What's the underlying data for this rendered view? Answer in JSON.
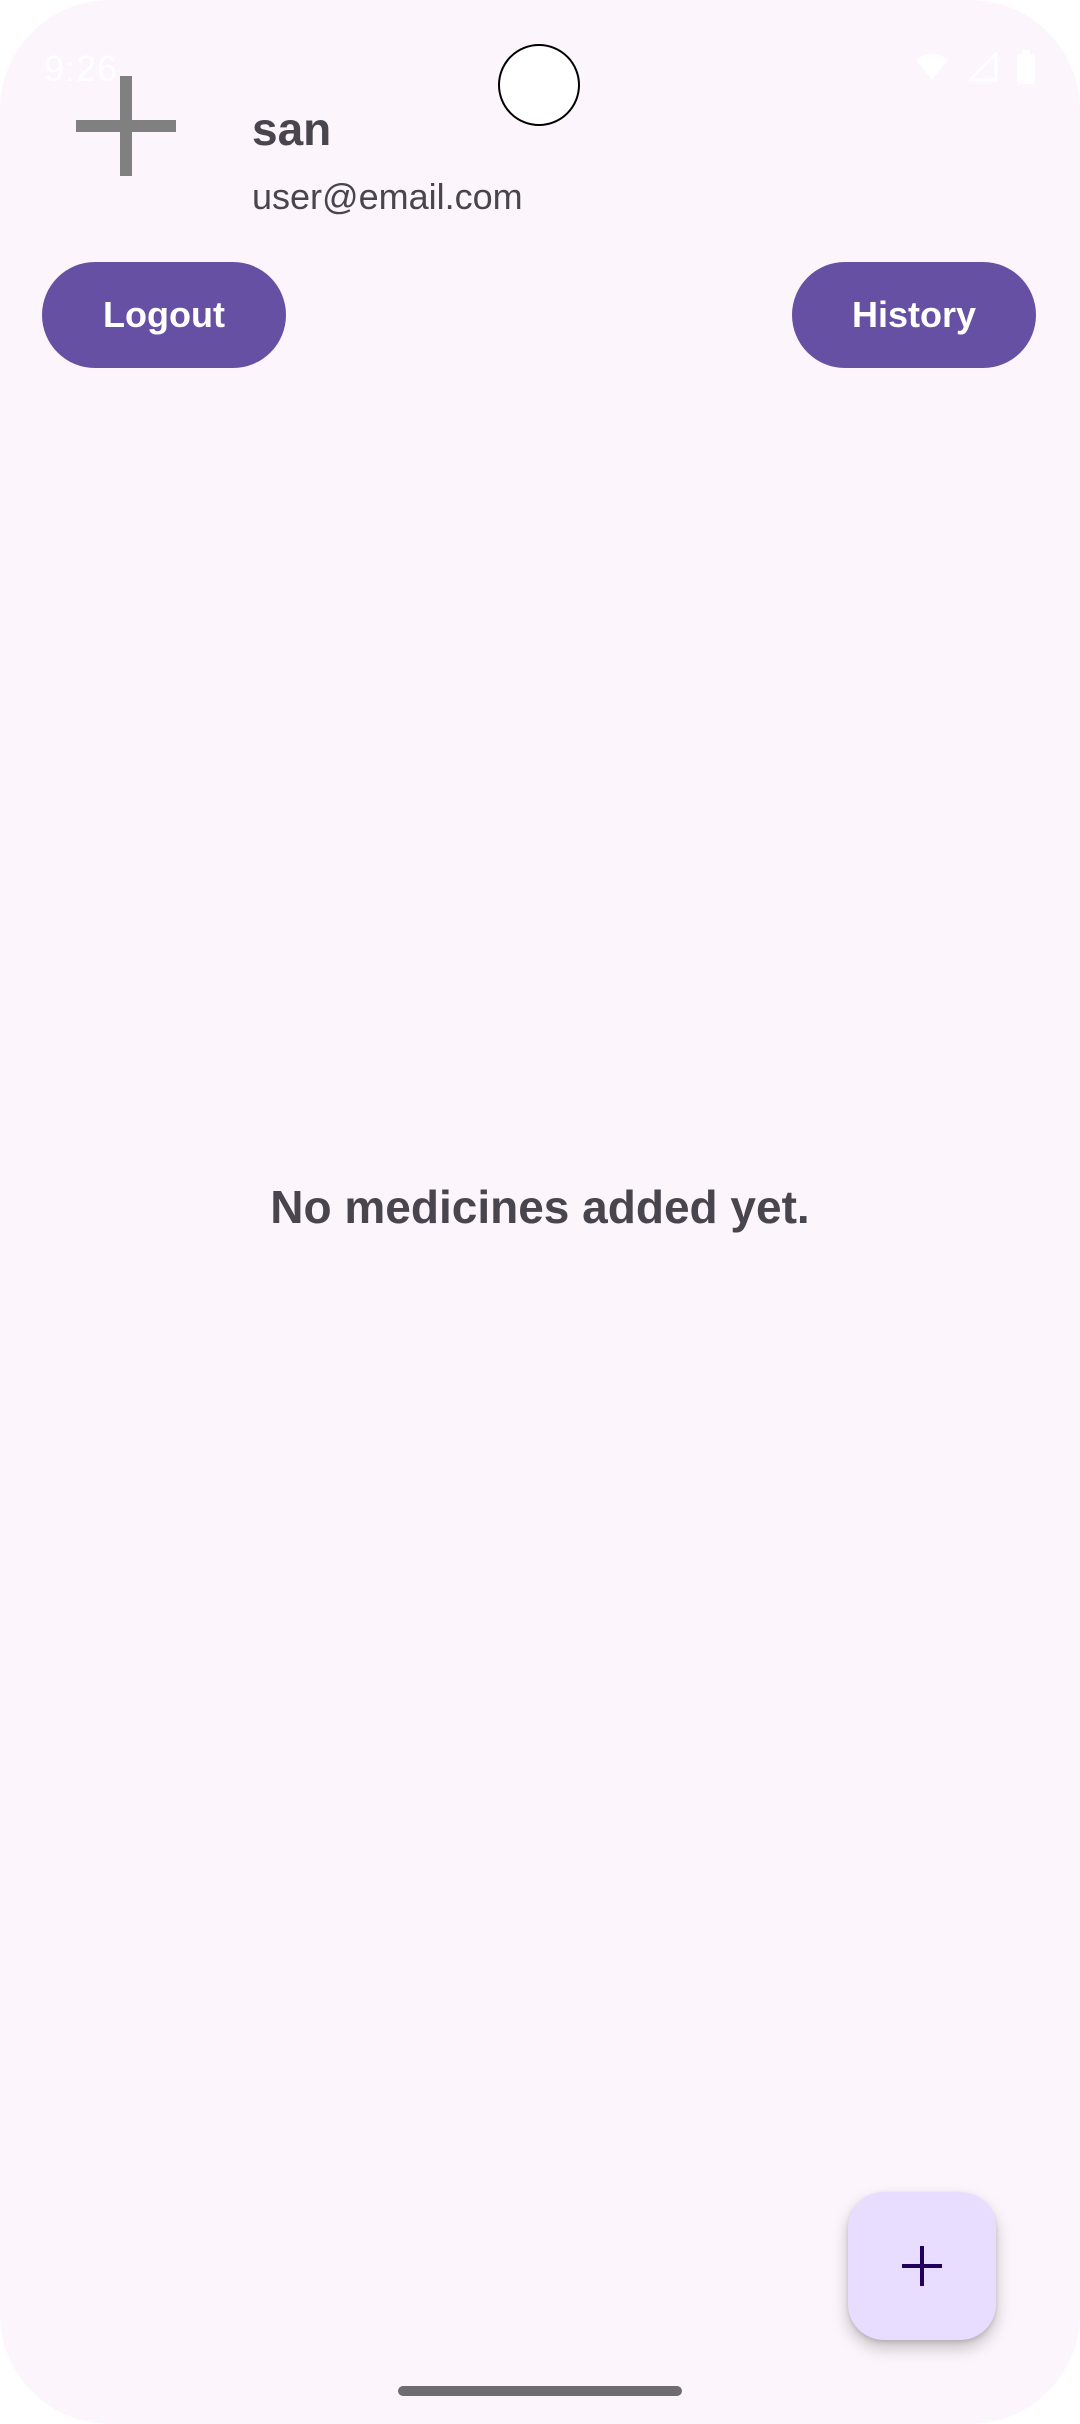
{
  "status_bar": {
    "time": "9:26",
    "icons": [
      "wifi-icon",
      "signal-icon",
      "battery-icon"
    ]
  },
  "header": {
    "avatar_icon": "plus-icon",
    "user_name": "san",
    "user_email": "user@email.com"
  },
  "actions": {
    "logout_label": "Logout",
    "history_label": "History"
  },
  "main": {
    "empty_message": "No medicines added yet."
  },
  "fab": {
    "icon": "add-icon"
  },
  "colors": {
    "background": "#fcf5fb",
    "primary": "#6650a4",
    "fab_container": "#e9ddff",
    "on_fab": "#21005d",
    "text": "#49454f"
  }
}
